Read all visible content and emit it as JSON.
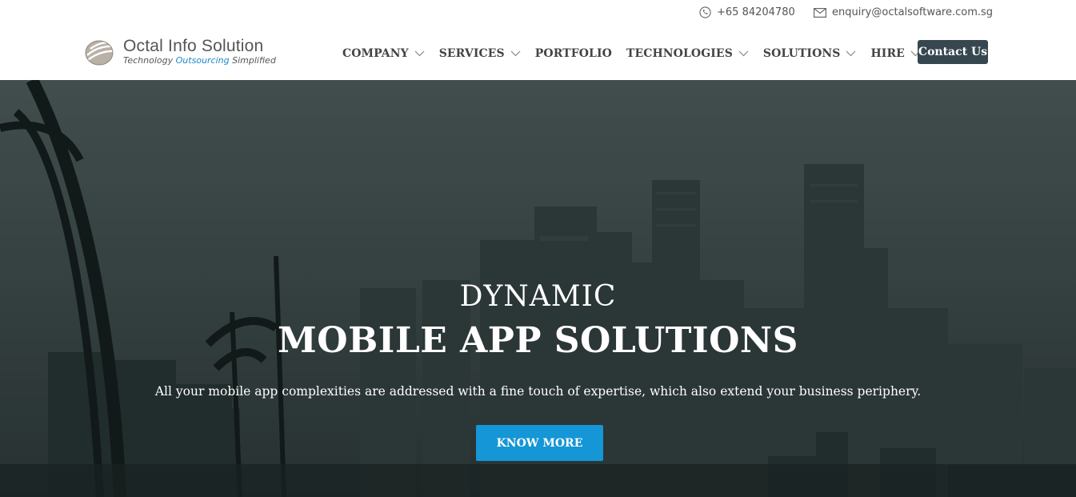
{
  "topbar": {
    "phone": "+65 84204780",
    "email": "enquiry@octalsoftware.com.sg",
    "phone_icon": "phone-icon",
    "email_icon": "mail-icon"
  },
  "logo": {
    "name": "Octal Info Solution",
    "tagline_pre": "Technology ",
    "tagline_accent": "Outsourcing",
    "tagline_post": " Simplified"
  },
  "nav": {
    "items": [
      {
        "label": "COMPANY",
        "dropdown": true
      },
      {
        "label": "SERVICES",
        "dropdown": true
      },
      {
        "label": "PORTFOLIO",
        "dropdown": false
      },
      {
        "label": "TECHNOLOGIES",
        "dropdown": true
      },
      {
        "label": "SOLUTIONS",
        "dropdown": true
      },
      {
        "label": "HIRE",
        "dropdown": true
      }
    ],
    "contact_label": "Contact Us"
  },
  "hero": {
    "subtitle": "DYNAMIC",
    "title": "MOBILE APP SOLUTIONS",
    "description": "All your mobile app complexities are addressed with a fine touch of expertise, which also extend your business periphery.",
    "cta_label": "KNOW MORE"
  },
  "colors": {
    "accent": "#1596d6",
    "contact_button": "#37474f",
    "logo_accent": "#1a88c9"
  }
}
